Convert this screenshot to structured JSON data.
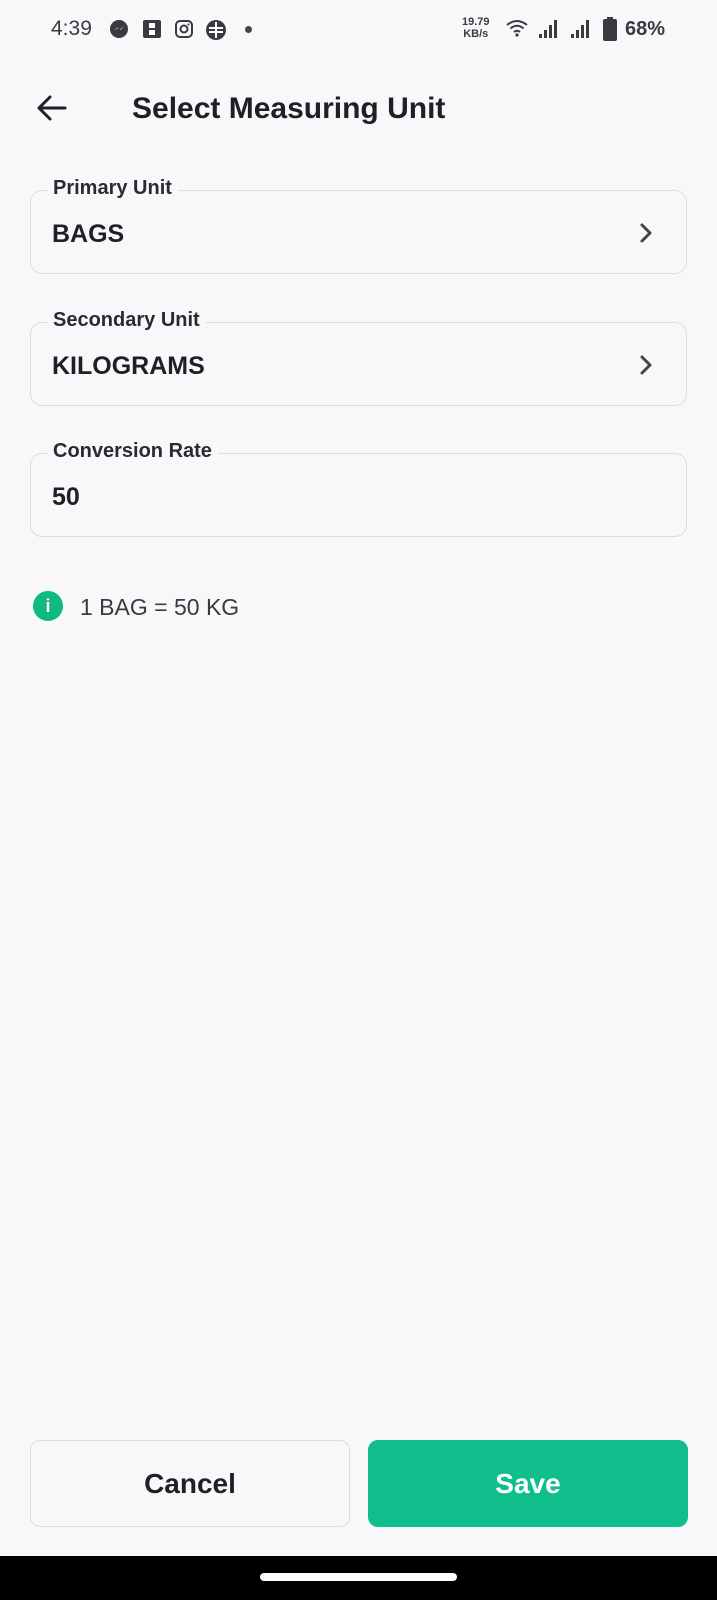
{
  "status_bar": {
    "time": "4:39",
    "speed_value": "19.79",
    "speed_unit": "KB/s",
    "battery": "68%",
    "icons": [
      "messenger-icon",
      "app-icon",
      "instagram-icon",
      "app-icon-2",
      "wifi-icon",
      "signal-icon",
      "signal-icon-2",
      "battery-icon"
    ]
  },
  "header": {
    "title": "Select Measuring Unit",
    "back_icon": "arrow-left-icon"
  },
  "fields": {
    "primary": {
      "label": "Primary Unit",
      "value": "BAGS"
    },
    "secondary": {
      "label": "Secondary Unit",
      "value": "KILOGRAMS"
    },
    "conversion": {
      "label": "Conversion Rate",
      "value": "50"
    }
  },
  "info": {
    "icon_glyph": "i",
    "text": "1 BAG = 50 KG"
  },
  "actions": {
    "cancel_label": "Cancel",
    "save_label": "Save"
  },
  "colors": {
    "accent": "#10be8b",
    "background": "#f8f8fb"
  }
}
